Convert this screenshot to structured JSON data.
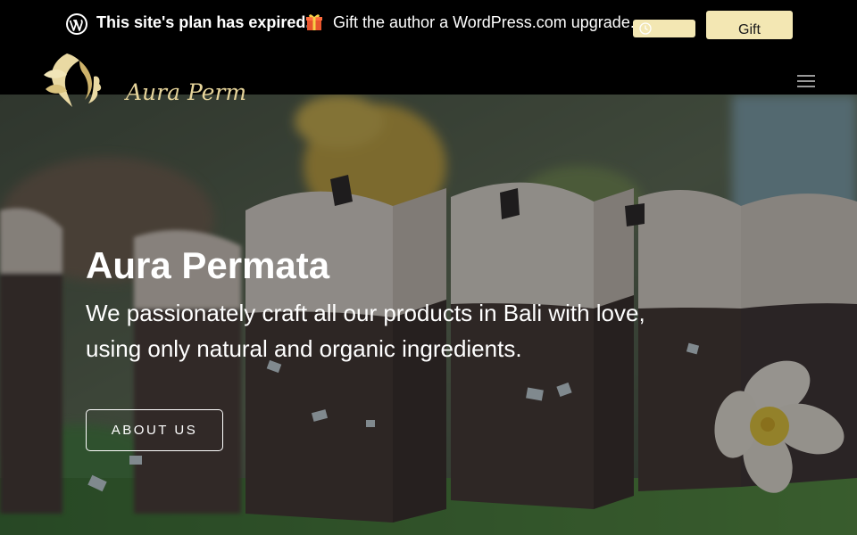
{
  "banner": {
    "logo_icon": "wordpress-logo-icon",
    "title": "This site's plan has expired.",
    "emoji_icon": "gift-emoji-icon",
    "message": "Gift the author a WordPress.com upgrade.",
    "dismiss_icon": "clock-icon",
    "gift_label": "Gift",
    "button_color": "#f3e7b3"
  },
  "header": {
    "logo_text": "Aura Permata",
    "logo_color": "#d9c58a",
    "menu_icon": "hamburger-menu-icon"
  },
  "hero": {
    "title": "Aura Permata",
    "subtitle": "We passionately craft all our products in Bali with love, using only natural and organic ingredients.",
    "cta_label": "ABOUT US",
    "background": "handmade soap bars with frangipani flowers"
  }
}
